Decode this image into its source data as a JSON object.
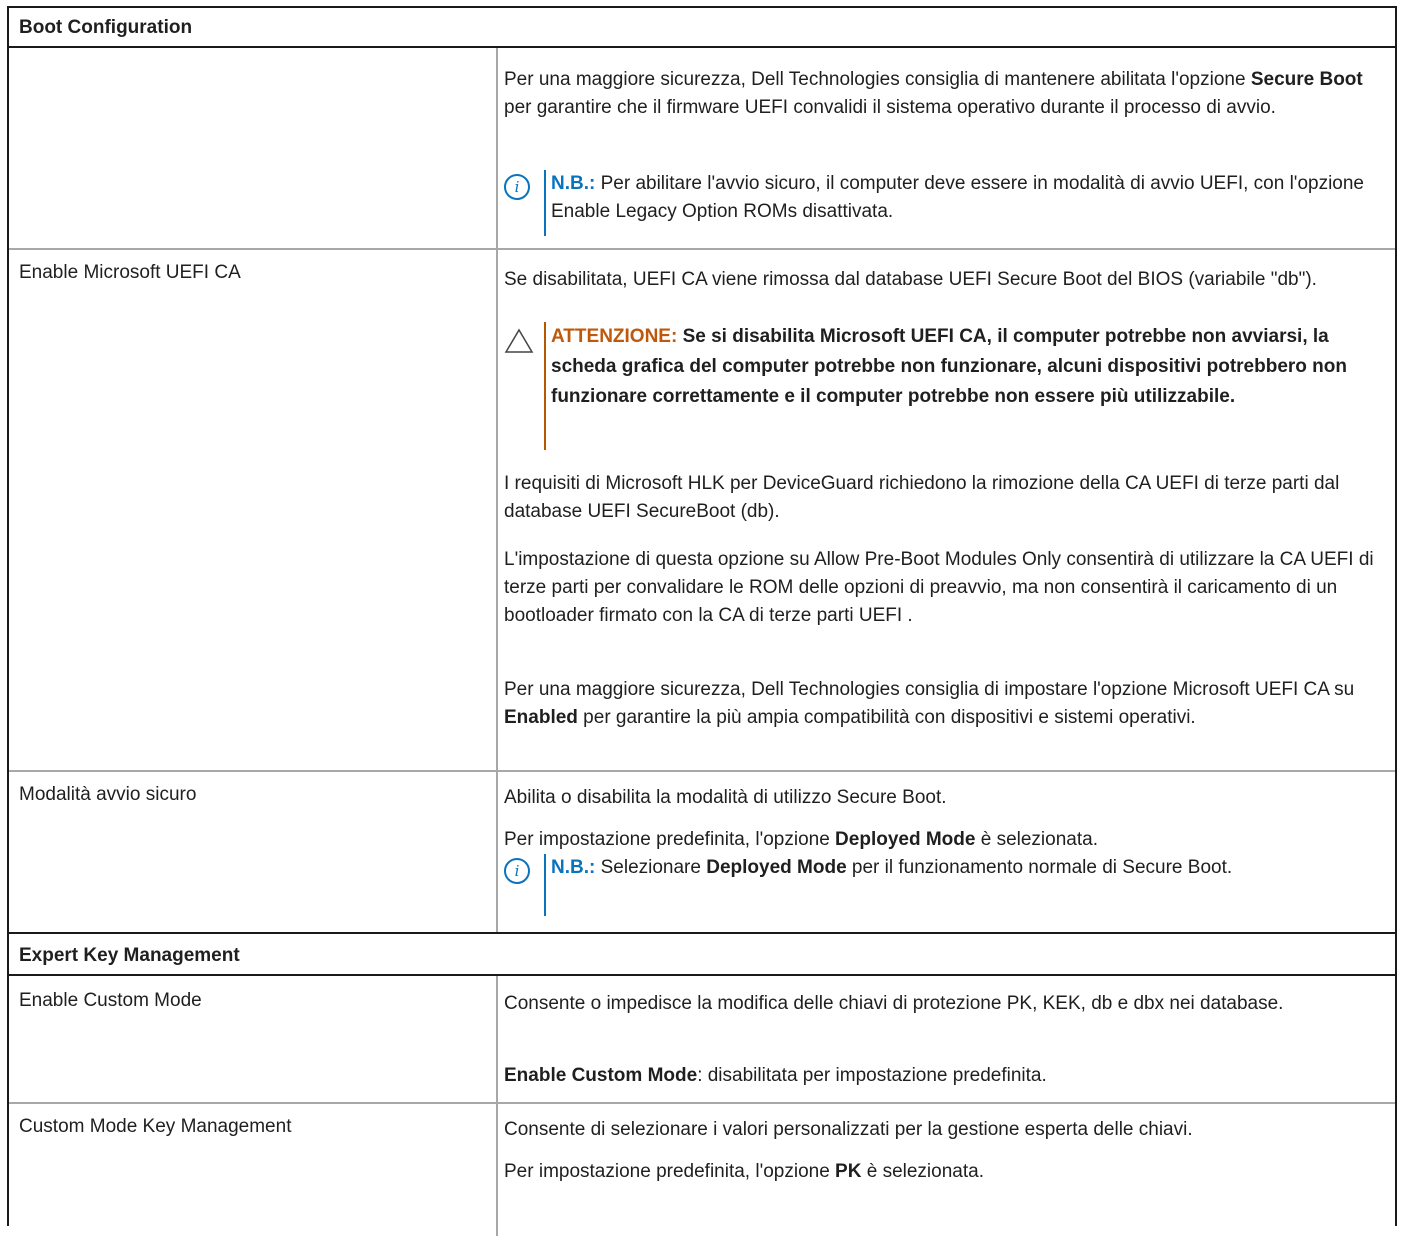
{
  "section1": {
    "title": "Boot Configuration",
    "row0": {
      "label": "",
      "para_pre": "Per una maggiore sicurezza, Dell Technologies consiglia di mantenere abilitata l'opzione ",
      "para_bold": "Secure Boot",
      "para_post": " per garantire che il firmware UEFI convalidi il sistema operativo durante il processo di avvio.",
      "note_label": "N.B.:",
      "note_text": " Per abilitare l'avvio sicuro, il computer deve essere in modalità di avvio UEFI, con l'opzione Enable Legacy Option ROMs disattivata."
    },
    "row1": {
      "label": "Enable Microsoft UEFI CA",
      "p1": "Se disabilitata, UEFI CA viene rimossa dal database UEFI Secure Boot del BIOS (variabile \"db\").",
      "caution_label": "ATTENZIONE:",
      "caution_text": " Se si disabilita Microsoft UEFI CA, il computer potrebbe non avviarsi, la scheda grafica del computer potrebbe non funzionare, alcuni dispositivi potrebbero non funzionare correttamente e il computer potrebbe non essere più utilizzabile.",
      "p2": "I requisiti di Microsoft HLK per DeviceGuard richiedono la rimozione della CA UEFI di terze parti dal database UEFI SecureBoot (db).",
      "p3": "L'impostazione di questa opzione su Allow Pre-Boot Modules Only consentirà di utilizzare la CA UEFI di terze parti per convalidare le ROM delle opzioni di preavvio, ma non consentirà il caricamento di un bootloader firmato con la CA di terze parti UEFI .",
      "p4_pre": "Per una maggiore sicurezza, Dell Technologies consiglia di impostare l'opzione Microsoft UEFI CA su ",
      "p4_bold": "Enabled",
      "p4_post": " per garantire la più ampia compatibilità con dispositivi e sistemi operativi."
    },
    "row2": {
      "label": "Modalità avvio sicuro",
      "p1": "Abilita o disabilita la modalità di utilizzo Secure Boot.",
      "p2_pre": "Per impostazione predefinita, l'opzione ",
      "p2_bold": "Deployed Mode",
      "p2_post": " è selezionata.",
      "note_label": "N.B.:",
      "note_pre": " Selezionare ",
      "note_bold": "Deployed Mode",
      "note_post": " per il funzionamento normale di Secure Boot."
    }
  },
  "section2": {
    "title": "Expert Key Management",
    "row0": {
      "label": "Enable Custom Mode",
      "p1": "Consente o impedisce la modifica delle chiavi di protezione PK, KEK, db e dbx nei database.",
      "p2_bold": "Enable Custom Mode",
      "p2_post": ": disabilitata per impostazione predefinita."
    },
    "row1": {
      "label": "Custom Mode Key Management",
      "p1": "Consente di selezionare i valori personalizzati per la gestione esperta delle chiavi.",
      "p2_pre": "Per impostazione predefinita, l'opzione ",
      "p2_bold": "PK",
      "p2_post": " è selezionata."
    }
  },
  "colors": {
    "note": "#0a73be",
    "caution": "#c0580b",
    "border": "#1a1a1a",
    "row_sep": "#a8a8a8"
  }
}
